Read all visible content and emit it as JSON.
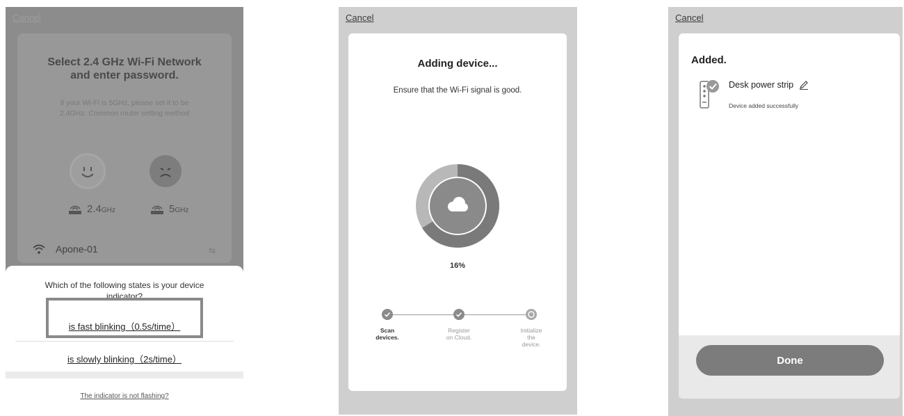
{
  "screen1": {
    "cancel": "Cancel",
    "title_lines": [
      "Select 2.4 GHz Wi-Fi Network",
      "and enter password."
    ],
    "subtitle_lines": [
      "If your Wi-Fi is 5GHz, please set it to be",
      "2.4GHz. Common router setting method"
    ],
    "band_24": "2.4",
    "band_24_unit": "GHz",
    "band_5": "5",
    "band_5_unit": "GHz",
    "network_name": "Apone-01",
    "question_lines": [
      "Which of the following states is your device",
      "indicator?"
    ],
    "option_fast": "is fast blinking（0.5s/time）",
    "option_slow": "is slowly blinking（2s/time）",
    "not_flashing_link": "The indicator is not flashing?"
  },
  "screen2": {
    "cancel": "Cancel",
    "title": "Adding device...",
    "subtitle": "Ensure that the Wi-Fi signal is good.",
    "progress_percent": 16,
    "progress_label": "16%",
    "steps": [
      {
        "lines": [
          "Scan",
          "devices."
        ],
        "done": true
      },
      {
        "lines": [
          "Register",
          "on Cloud."
        ],
        "done": true
      },
      {
        "lines": [
          "Initialize",
          "the",
          "device."
        ],
        "done": false
      }
    ]
  },
  "screen3": {
    "cancel": "Cancel",
    "title": "Added.",
    "device_name": "Desk power strip",
    "device_status": "Device added successfully",
    "done_label": "Done"
  },
  "colors": {
    "phone_bg": "#cfcfcf",
    "card_bg": "#ffffff",
    "overlay": "#8c8c8c",
    "progress_dark": "#7a7a7a",
    "progress_light": "#b8b8b8",
    "button": "#7c7c7c"
  },
  "icons": [
    "smile-face-icon",
    "sad-face-icon",
    "router-icon",
    "wifi-icon",
    "swap-icon",
    "cloud-icon",
    "check-icon",
    "power-strip-icon",
    "edit-pencil-icon"
  ]
}
